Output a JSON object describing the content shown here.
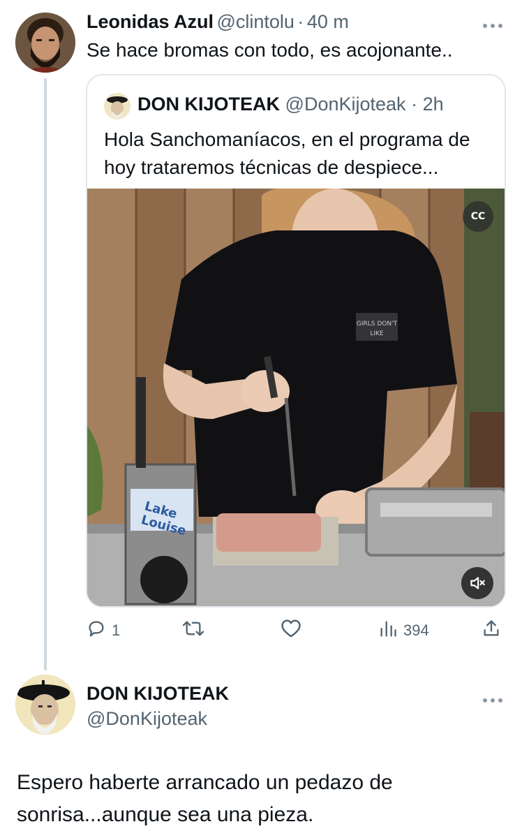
{
  "tweet1": {
    "display_name": "Leonidas Azul",
    "handle": "@clintolu",
    "separator": "·",
    "time": "40 m",
    "text": "Se hace bromas con todo, es acojonante..",
    "more_icon": "more-horizontal-icon"
  },
  "quote": {
    "display_name": "DON KIJOTEAK",
    "handle": "@DonKijoteak",
    "separator": "·",
    "time": "2h",
    "text": "Hola Sanchomaníacos, en el programa de hoy trataremos técnicas de despiece...",
    "video": {
      "cc_label": "CC",
      "box_label_line1": "Lake",
      "box_label_line2": "Louise"
    }
  },
  "actions": {
    "reply_count": "1",
    "retweet_count": "",
    "like_count": "",
    "views_count": "394"
  },
  "tweet2": {
    "display_name": "DON KIJOTEAK",
    "handle": "@DonKijoteak",
    "text": "Espero haberte arrancado un pedazo de sonrisa...aunque sea una pieza."
  },
  "colors": {
    "text": "#0f1419",
    "muted": "#536471",
    "border": "#e1e8ed",
    "thread_line": "#cfd9de"
  }
}
